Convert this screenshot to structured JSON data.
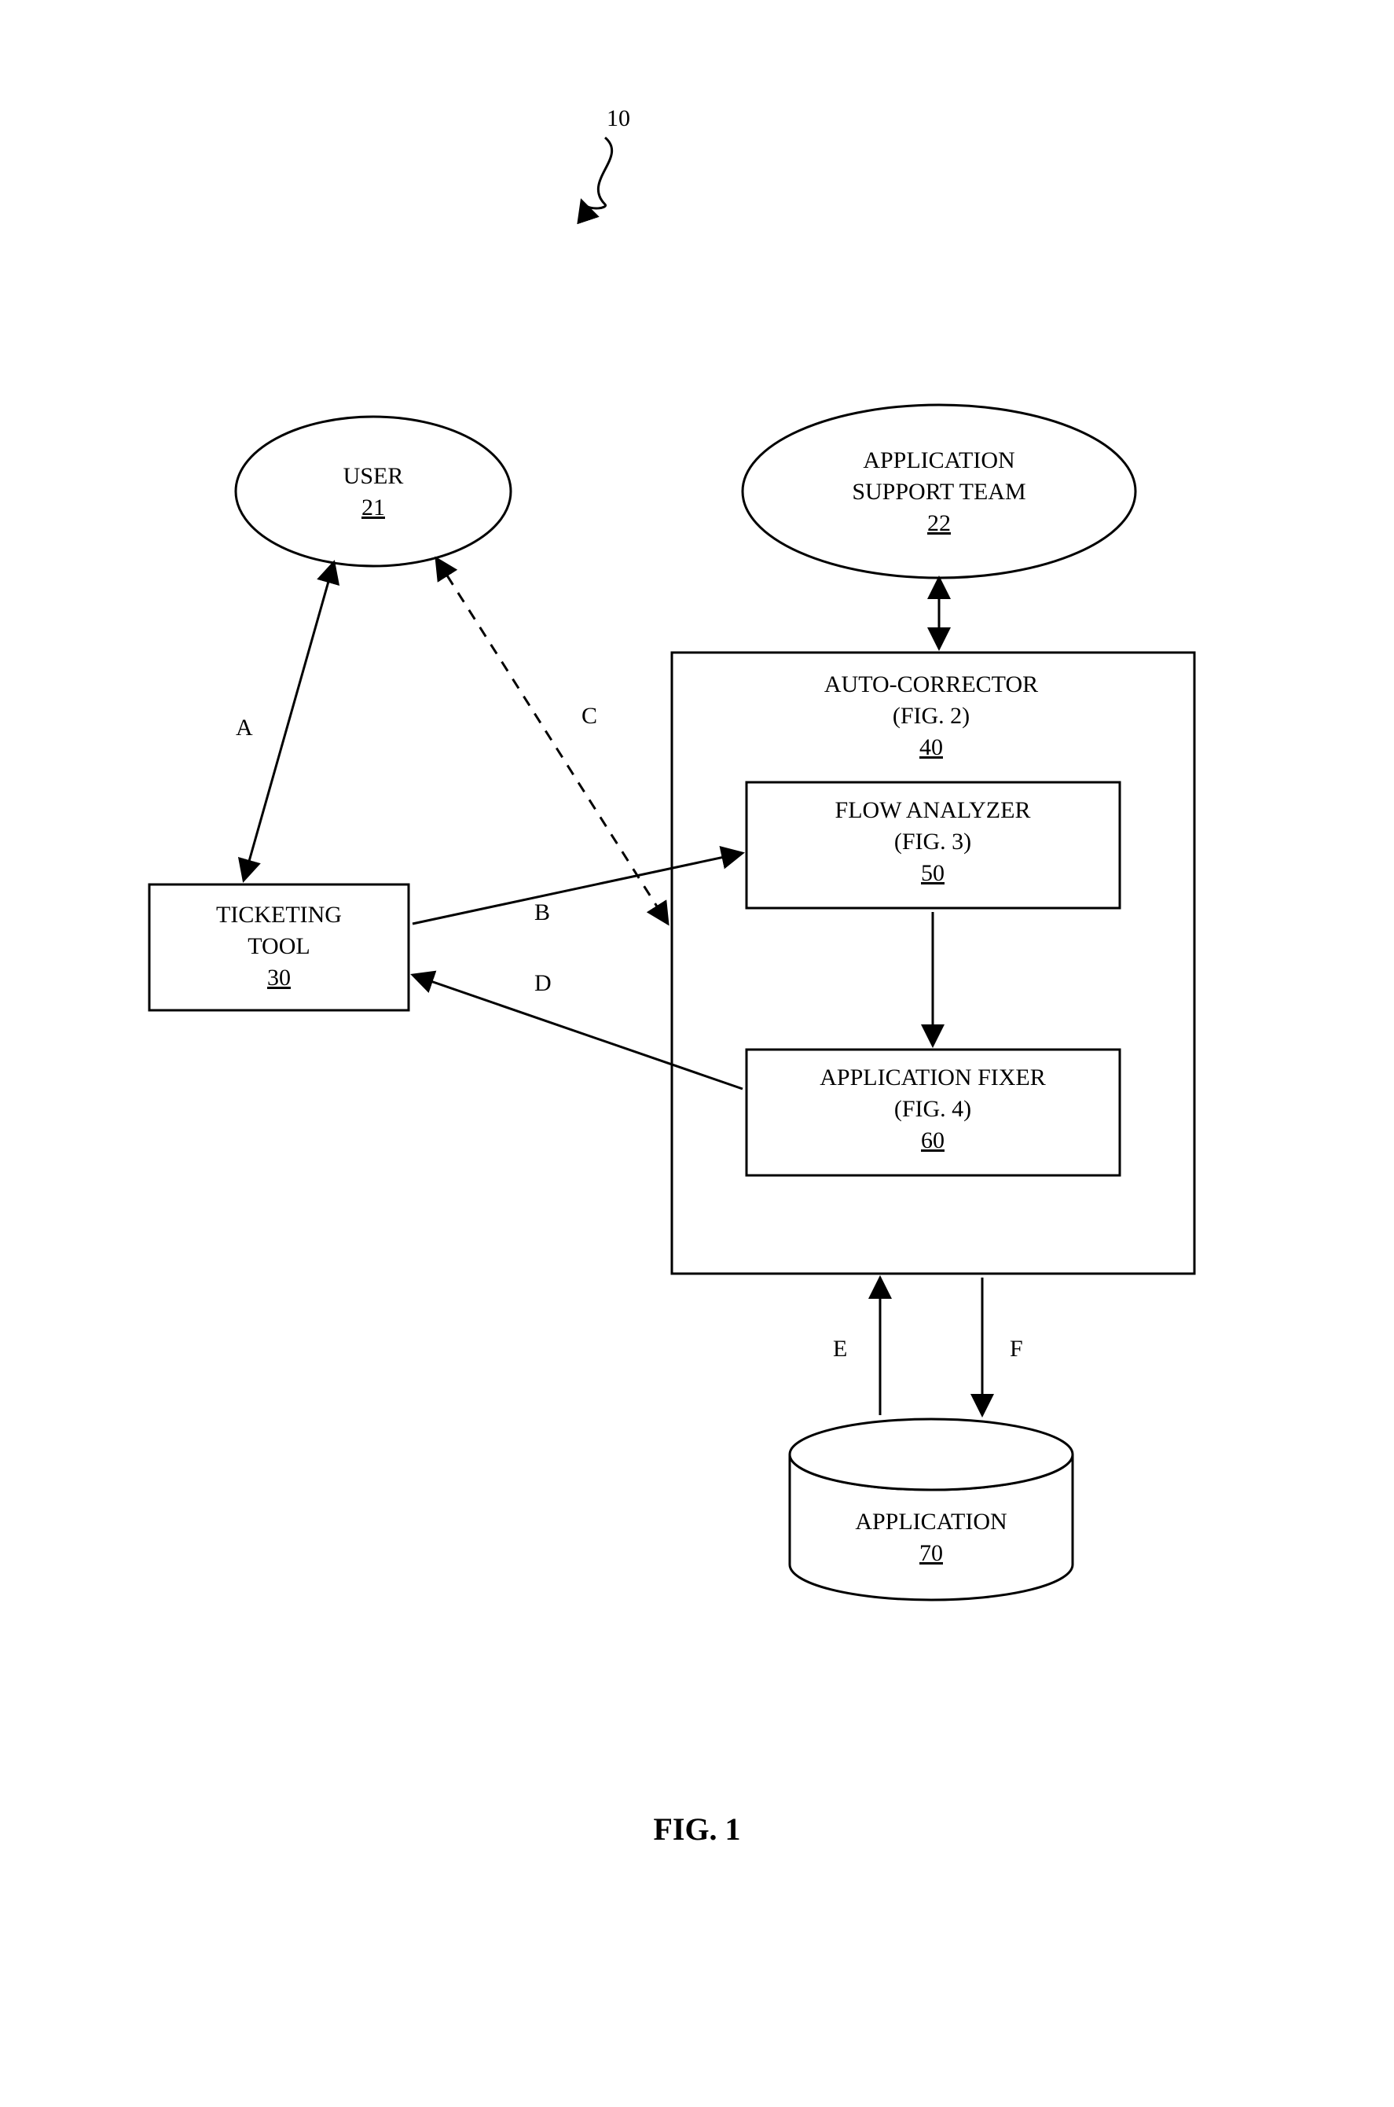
{
  "figure": {
    "number_top": "10",
    "caption": "FIG. 1",
    "nodes": {
      "user": {
        "label": "USER",
        "num": "21"
      },
      "support_team": {
        "label1": "APPLICATION",
        "label2": "SUPPORT TEAM",
        "num": "22"
      },
      "ticketing": {
        "label1": "TICKETING",
        "label2": "TOOL",
        "num": "30"
      },
      "auto_corrector": {
        "label1": "AUTO-CORRECTOR",
        "label2": "(FIG. 2)",
        "num": "40"
      },
      "flow_analyzer": {
        "label1": "FLOW ANALYZER",
        "label2": "(FIG. 3)",
        "num": "50"
      },
      "app_fixer": {
        "label1": "APPLICATION FIXER",
        "label2": "(FIG. 4)",
        "num": "60"
      },
      "application": {
        "label": "APPLICATION",
        "num": "70"
      }
    },
    "edges": {
      "A": "A",
      "B": "B",
      "C": "C",
      "D": "D",
      "E": "E",
      "F": "F"
    }
  }
}
